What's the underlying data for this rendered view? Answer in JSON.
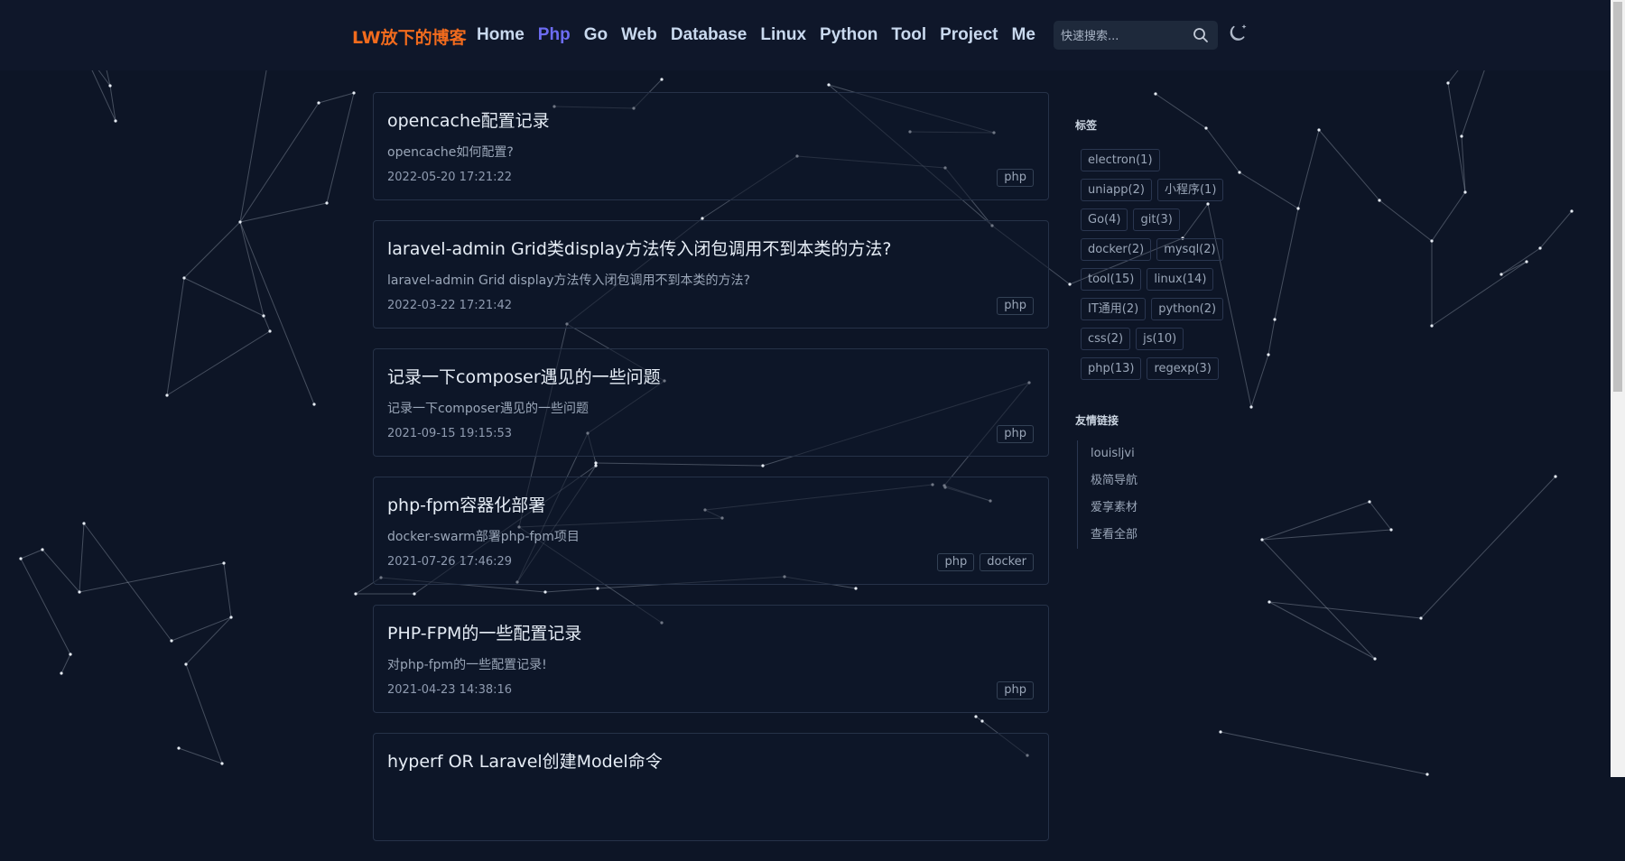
{
  "header": {
    "brand": "LW放下的博客",
    "nav": [
      {
        "label": "Home",
        "active": false
      },
      {
        "label": "Php",
        "active": true
      },
      {
        "label": "Go",
        "active": false
      },
      {
        "label": "Web",
        "active": false
      },
      {
        "label": "Database",
        "active": false
      },
      {
        "label": "Linux",
        "active": false
      },
      {
        "label": "Python",
        "active": false
      },
      {
        "label": "Tool",
        "active": false
      },
      {
        "label": "Project",
        "active": false
      },
      {
        "label": "Me",
        "active": false
      }
    ],
    "search": {
      "placeholder": "快速搜索...",
      "icon": "search-icon"
    },
    "theme_toggle_icon": "moon-icon"
  },
  "posts": [
    {
      "title": "opencache配置记录",
      "desc": "opencache如何配置?",
      "date": "2022-05-20 17:21:22",
      "tags": [
        "php"
      ]
    },
    {
      "title": "laravel-admin Grid类display方法传入闭包调用不到本类的方法?",
      "desc": "laravel-admin Grid display方法传入闭包调用不到本类的方法?",
      "date": "2022-03-22 17:21:42",
      "tags": [
        "php"
      ]
    },
    {
      "title": "记录一下composer遇见的一些问题",
      "desc": "记录一下composer遇见的一些问题",
      "date": "2021-09-15 19:15:53",
      "tags": [
        "php"
      ]
    },
    {
      "title": "php-fpm容器化部署",
      "desc": "docker-swarm部署php-fpm项目",
      "date": "2021-07-26 17:46:29",
      "tags": [
        "php",
        "docker"
      ]
    },
    {
      "title": "PHP-FPM的一些配置记录",
      "desc": "对php-fpm的一些配置记录!",
      "date": "2021-04-23 14:38:16",
      "tags": [
        "php"
      ]
    },
    {
      "title": "hyperf OR Laravel创建Model命令",
      "desc": "",
      "date": "",
      "tags": []
    }
  ],
  "sidebar": {
    "tags_title": "标签",
    "tags": [
      "electron(1)",
      "uniapp(2)",
      "小程序(1)",
      "Go(4)",
      "git(3)",
      "docker(2)",
      "mysql(2)",
      "tool(15)",
      "linux(14)",
      "IT通用(2)",
      "python(2)",
      "css(2)",
      "js(10)",
      "php(13)",
      "regexp(3)"
    ],
    "links_title": "友情链接",
    "links": [
      "louisljvi",
      "极简导航",
      "爱享素材",
      "查看全部"
    ]
  },
  "colors": {
    "background": "#0d1526",
    "brand": "#f26b1d",
    "nav_active": "#6d6cf3",
    "nav": "#c9d9ee"
  }
}
